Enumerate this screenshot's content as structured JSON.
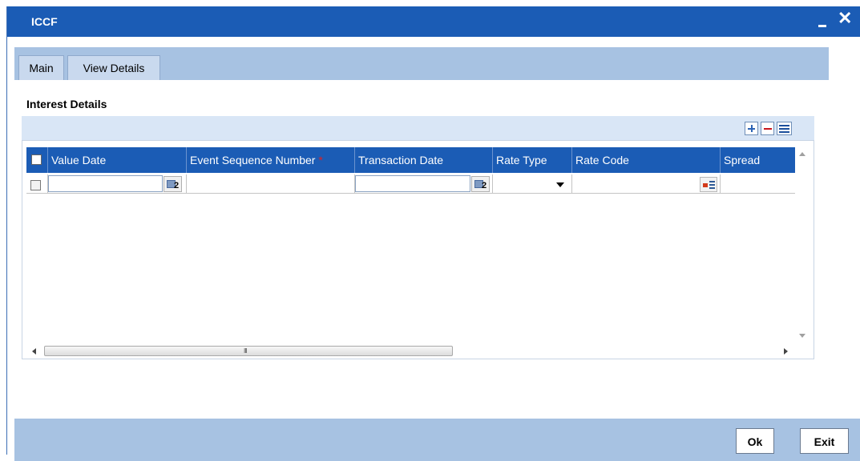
{
  "window": {
    "title": "ICCF",
    "minimize_icon": "minimize-icon",
    "close_label": "✕"
  },
  "tabs": [
    {
      "label": "Main"
    },
    {
      "label": "View Details"
    }
  ],
  "section": {
    "title": "Interest Details"
  },
  "toolbar": {
    "icons": [
      "add-row-icon",
      "delete-row-icon",
      "single-view-icon"
    ]
  },
  "table": {
    "columns": [
      {
        "label": "Value Date",
        "required": false
      },
      {
        "label": "Event Sequence Number",
        "required": true
      },
      {
        "label": "Transaction Date",
        "required": false
      },
      {
        "label": "Rate Type",
        "required": false
      },
      {
        "label": "Rate Code",
        "required": false
      },
      {
        "label": "Spread",
        "required": false
      }
    ],
    "required_marker": "*",
    "rows": [
      {
        "checked": false,
        "value_date": "",
        "event_sequence_number": "",
        "transaction_date": "",
        "rate_type": "",
        "rate_code": "",
        "spread": ""
      }
    ],
    "calendar_button_label": "2",
    "scrollbar_grip": "III"
  },
  "footer": {
    "ok_label": "Ok",
    "exit_label": "Exit"
  },
  "colors": {
    "header_blue": "#1b5cb5",
    "panel_blue": "#a7c2e2",
    "toolbar_bg": "#d9e6f6"
  }
}
